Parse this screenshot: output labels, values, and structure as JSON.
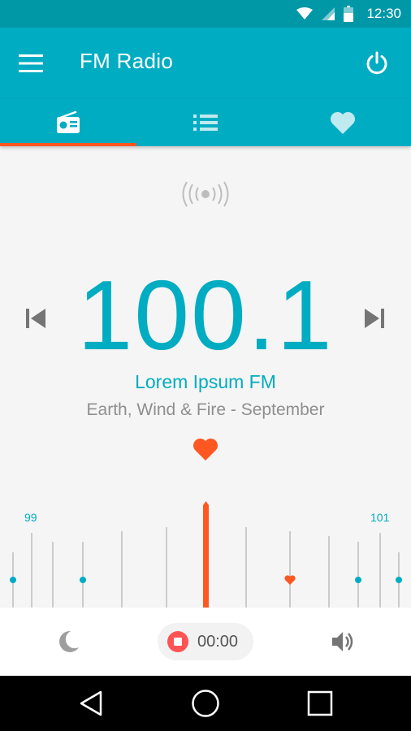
{
  "status_bar": {
    "time": "12:30"
  },
  "toolbar": {
    "title": "FM Radio"
  },
  "tabs": [
    {
      "name": "radio",
      "icon": "radio-icon",
      "selected": true
    },
    {
      "name": "list",
      "icon": "list-icon",
      "selected": false
    },
    {
      "name": "favorites",
      "icon": "heart-icon",
      "selected": false
    }
  ],
  "player": {
    "frequency": "100.1",
    "station": "Lorem Ipsum FM",
    "song": "Earth, Wind & Fire - September",
    "favorite": true
  },
  "dial": {
    "left_label": "99",
    "right_label": "101"
  },
  "recorder": {
    "time": "00:00"
  },
  "colors": {
    "primary": "#00acc1",
    "primary_dark": "#0097a7",
    "accent": "#ff5722",
    "record": "#ff5252"
  }
}
